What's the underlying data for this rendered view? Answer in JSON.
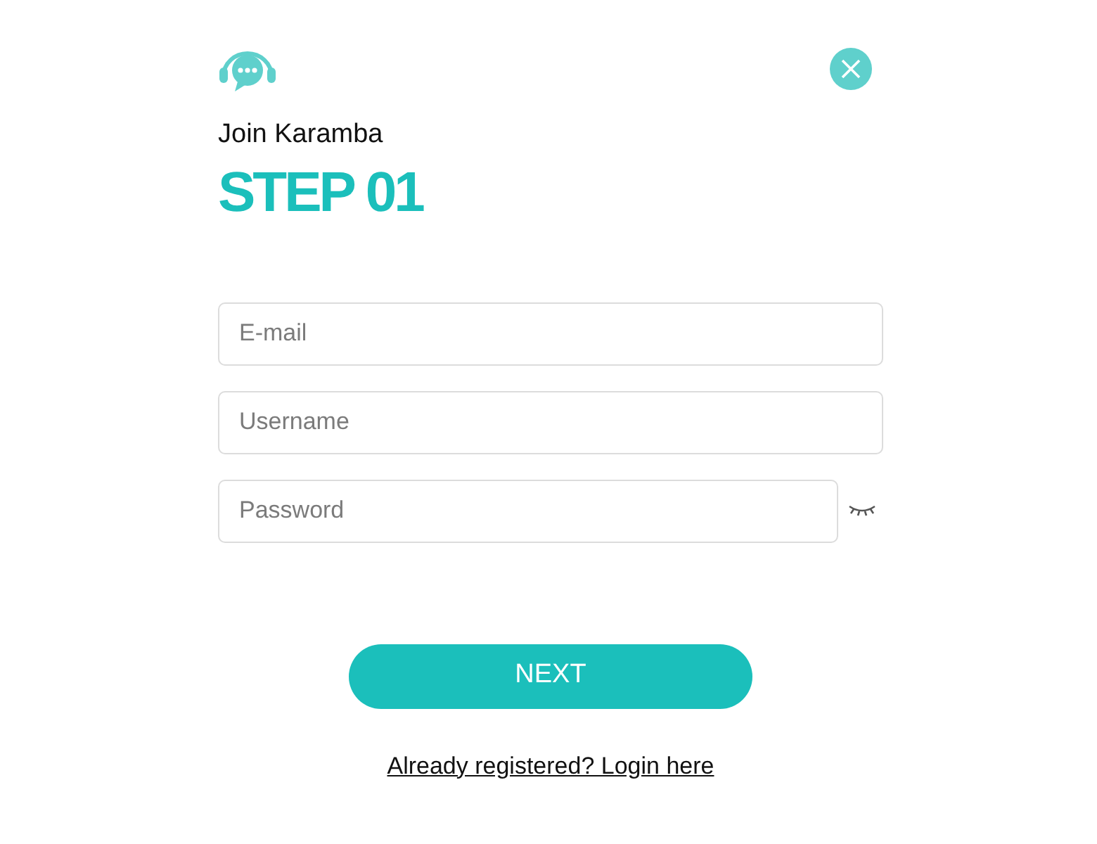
{
  "header": {
    "subtitle": "Join Karamba",
    "title": "STEP 01"
  },
  "fields": [
    {
      "kind": "text",
      "placeholder": "E-mail"
    },
    {
      "kind": "text",
      "placeholder": "Username"
    },
    {
      "kind": "password",
      "placeholder": "Password"
    }
  ],
  "primary_button": "NEXT",
  "login_link": "Already registered? Login here"
}
